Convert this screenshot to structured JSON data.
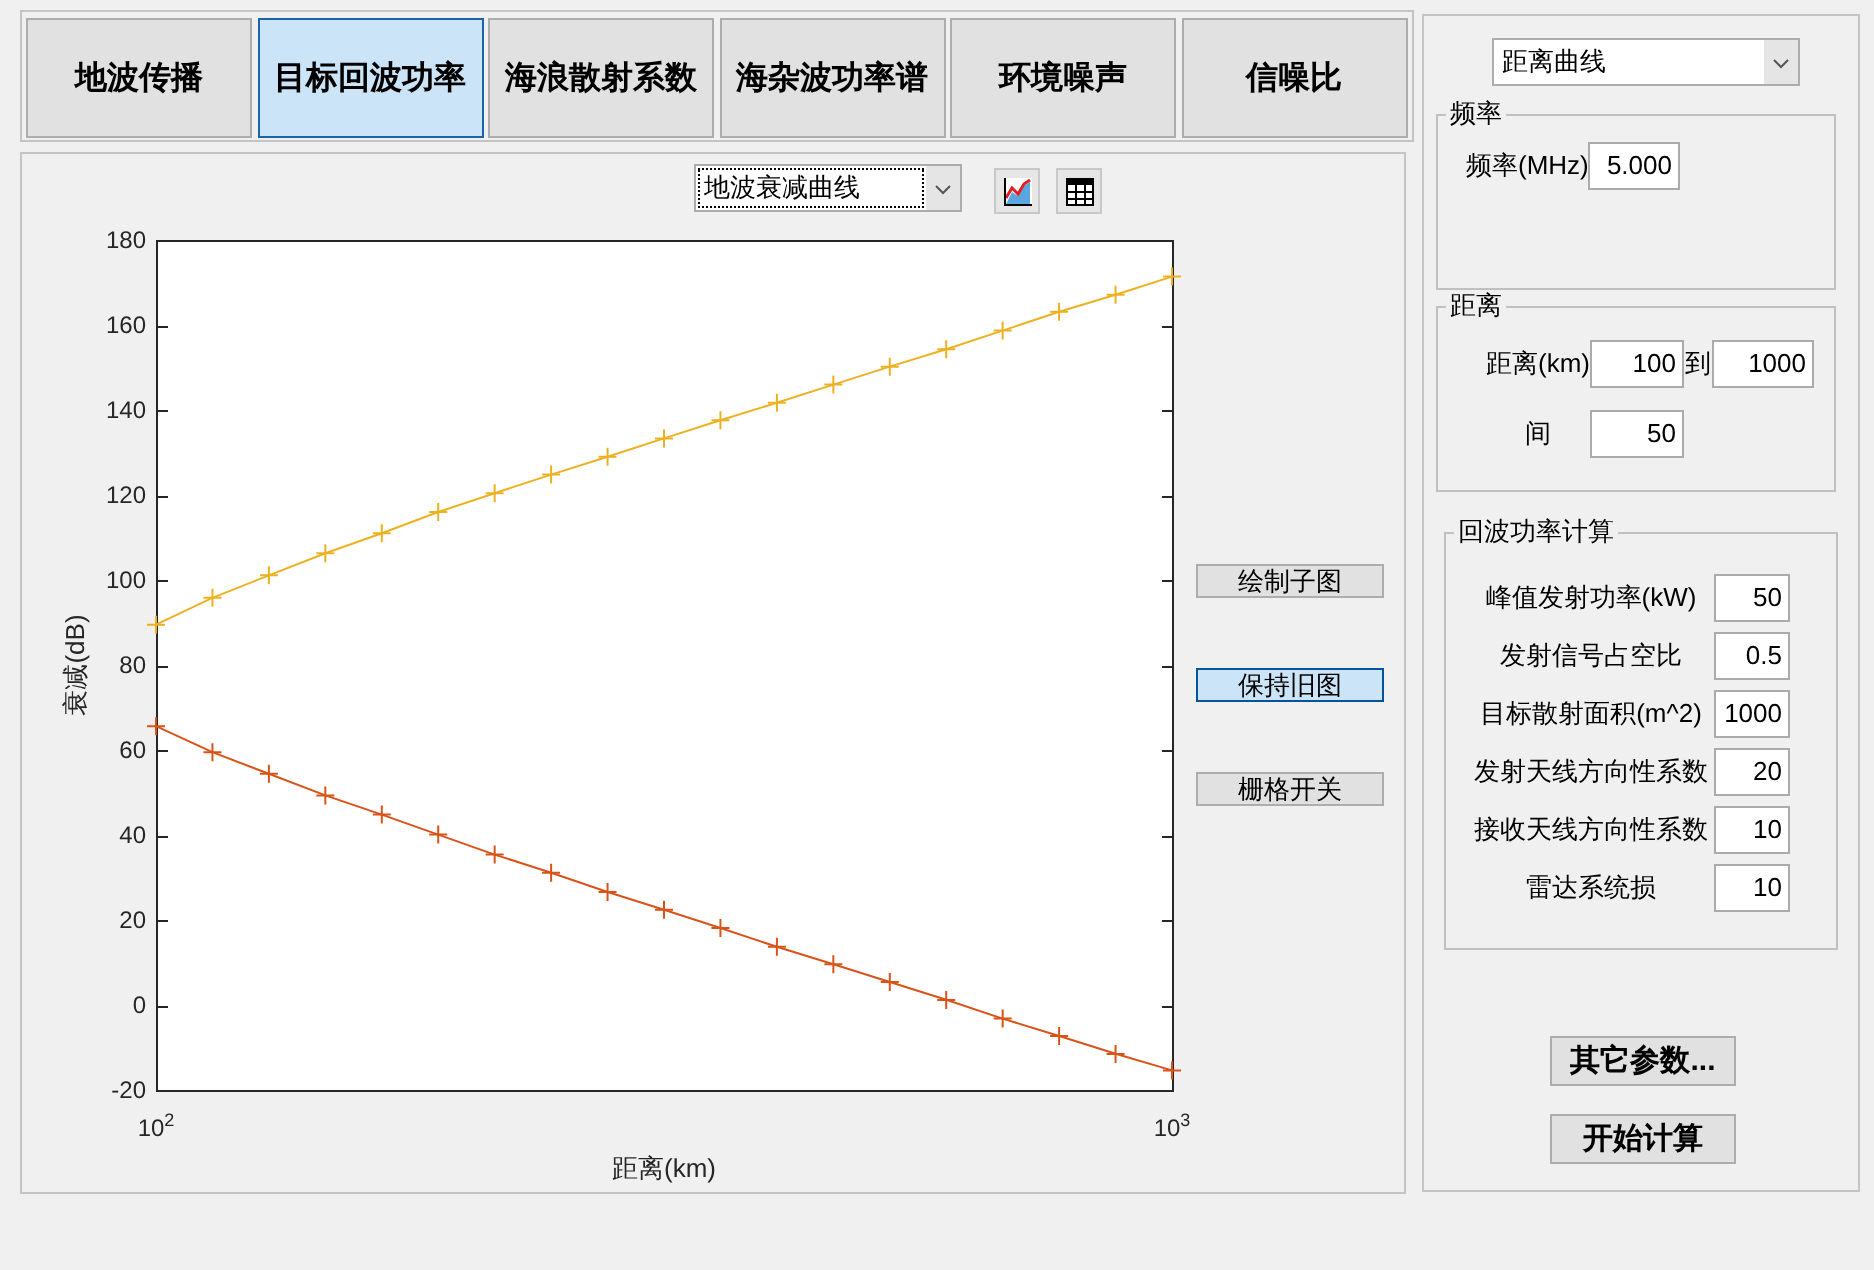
{
  "tabs": [
    {
      "label": "地波传播",
      "selected": false
    },
    {
      "label": "目标回波功率",
      "selected": true
    },
    {
      "label": "海浪散射系数",
      "selected": false
    },
    {
      "label": "海杂波功率谱",
      "selected": false
    },
    {
      "label": "环境噪声",
      "selected": false
    },
    {
      "label": "信噪比",
      "selected": false
    }
  ],
  "plot_panel": {
    "dropdown": {
      "value": "地波衰减曲线",
      "focused": true
    },
    "chart_data": {
      "type": "line",
      "xlabel": "距离(km)",
      "ylabel": "衰减(dB)",
      "x": [
        100,
        150,
        200,
        250,
        300,
        350,
        400,
        450,
        500,
        550,
        600,
        650,
        700,
        750,
        800,
        850,
        900,
        950,
        1000
      ],
      "series": [
        {
          "color": "#edb120",
          "marker": "+",
          "values": [
            89.5,
            95.8,
            101.1,
            106.3,
            111,
            116,
            120.4,
            124.8,
            129,
            133.3,
            137.6,
            141.7,
            146,
            150.2,
            154.3,
            158.7,
            163.1,
            167.1,
            171.4
          ]
        },
        {
          "color": "#d95319",
          "marker": "+",
          "values": [
            65.6,
            59.5,
            54.4,
            49.3,
            44.8,
            40.1,
            35.4,
            31.1,
            26.6,
            22.4,
            18.1,
            13.7,
            9.6,
            5.4,
            1.2,
            -3.2,
            -7.3,
            -11.5,
            -15.4
          ]
        }
      ],
      "xlim": [
        100,
        1000
      ],
      "ylim": [
        -20,
        180
      ],
      "xticks": [
        {
          "value": 100,
          "label": "10$^{2}$"
        },
        {
          "value": 1000,
          "label": "10$^{3}$"
        }
      ],
      "yticks": [
        -20,
        0,
        20,
        40,
        60,
        80,
        100,
        120,
        140,
        160,
        180
      ]
    },
    "buttons": [
      {
        "label": "绘制子图",
        "selected": false
      },
      {
        "label": "保持旧图",
        "selected": true
      },
      {
        "label": "栅格开关",
        "selected": false
      }
    ]
  },
  "settings_panel": {
    "dropdown": {
      "value": "距离曲线"
    },
    "groups": [
      {
        "title": "频率",
        "rows": [
          {
            "label": "频率(MHz)",
            "value": "5.000"
          }
        ]
      },
      {
        "title": "距离",
        "rows": [
          {
            "label": "距离(km)",
            "value": "100",
            "range_label": "到",
            "range_value": "1000"
          },
          {
            "label": "间",
            "value": "50"
          }
        ]
      },
      {
        "title": "回波功率计算",
        "rows": [
          {
            "label": "峰值发射功率(kW)",
            "value": "50"
          },
          {
            "label": "发射信号占空比",
            "value": "0.5"
          },
          {
            "label": "目标散射面积(m^2)",
            "value": "1000"
          },
          {
            "label": "发射天线方向性系数",
            "value": "20"
          },
          {
            "label": "接收天线方向性系数",
            "value": "10"
          },
          {
            "label": "雷达系统损",
            "value": "10"
          }
        ]
      }
    ],
    "buttons": [
      {
        "label": "其它参数..."
      },
      {
        "label": "开始计算"
      }
    ]
  }
}
